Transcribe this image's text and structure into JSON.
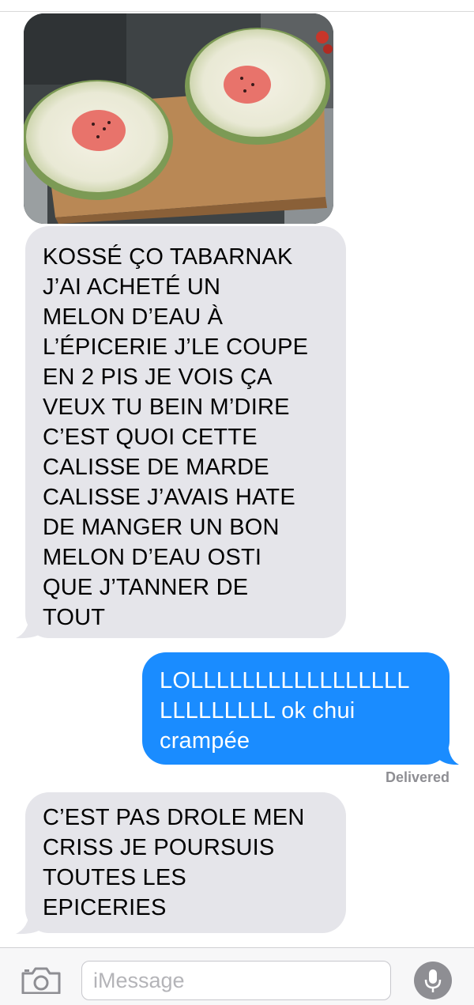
{
  "conversation": {
    "messages": [
      {
        "direction": "received",
        "text": "KOSSÉ ÇO TABARNAK\nJ’AI ACHETÉ UN\nMELON D’EAU À\nL’ÉPICERIE J’LE COUPE\nEN 2 PIS JE VOIS ÇA\nVEUX TU BEIN M’DIRE\nC’EST QUOI CETTE\nCALISSE DE MARDE\nCALISSE J’AVAIS HATE\nDE MANGER UN BON\nMELON D’EAU OSTI\nQUE J’TANNER DE\nTOUT"
      },
      {
        "direction": "sent",
        "text": "LOLLLLLLLLLLLLLLLLL\nLLLLLLLLL ok chui\ncrampée"
      },
      {
        "direction": "received",
        "text": "C’EST PAS DROLE MEN\nCRISS JE POURSUIS\nTOUTES LES\nEPICERIES"
      }
    ],
    "delivered_label": "Delivered"
  },
  "input_bar": {
    "placeholder": "iMessage",
    "camera_icon": "camera-icon",
    "mic_icon": "microphone-icon"
  },
  "colors": {
    "received_bubble": "#e5e5ea",
    "sent_bubble": "#1a8cff",
    "background": "#ffffff"
  }
}
